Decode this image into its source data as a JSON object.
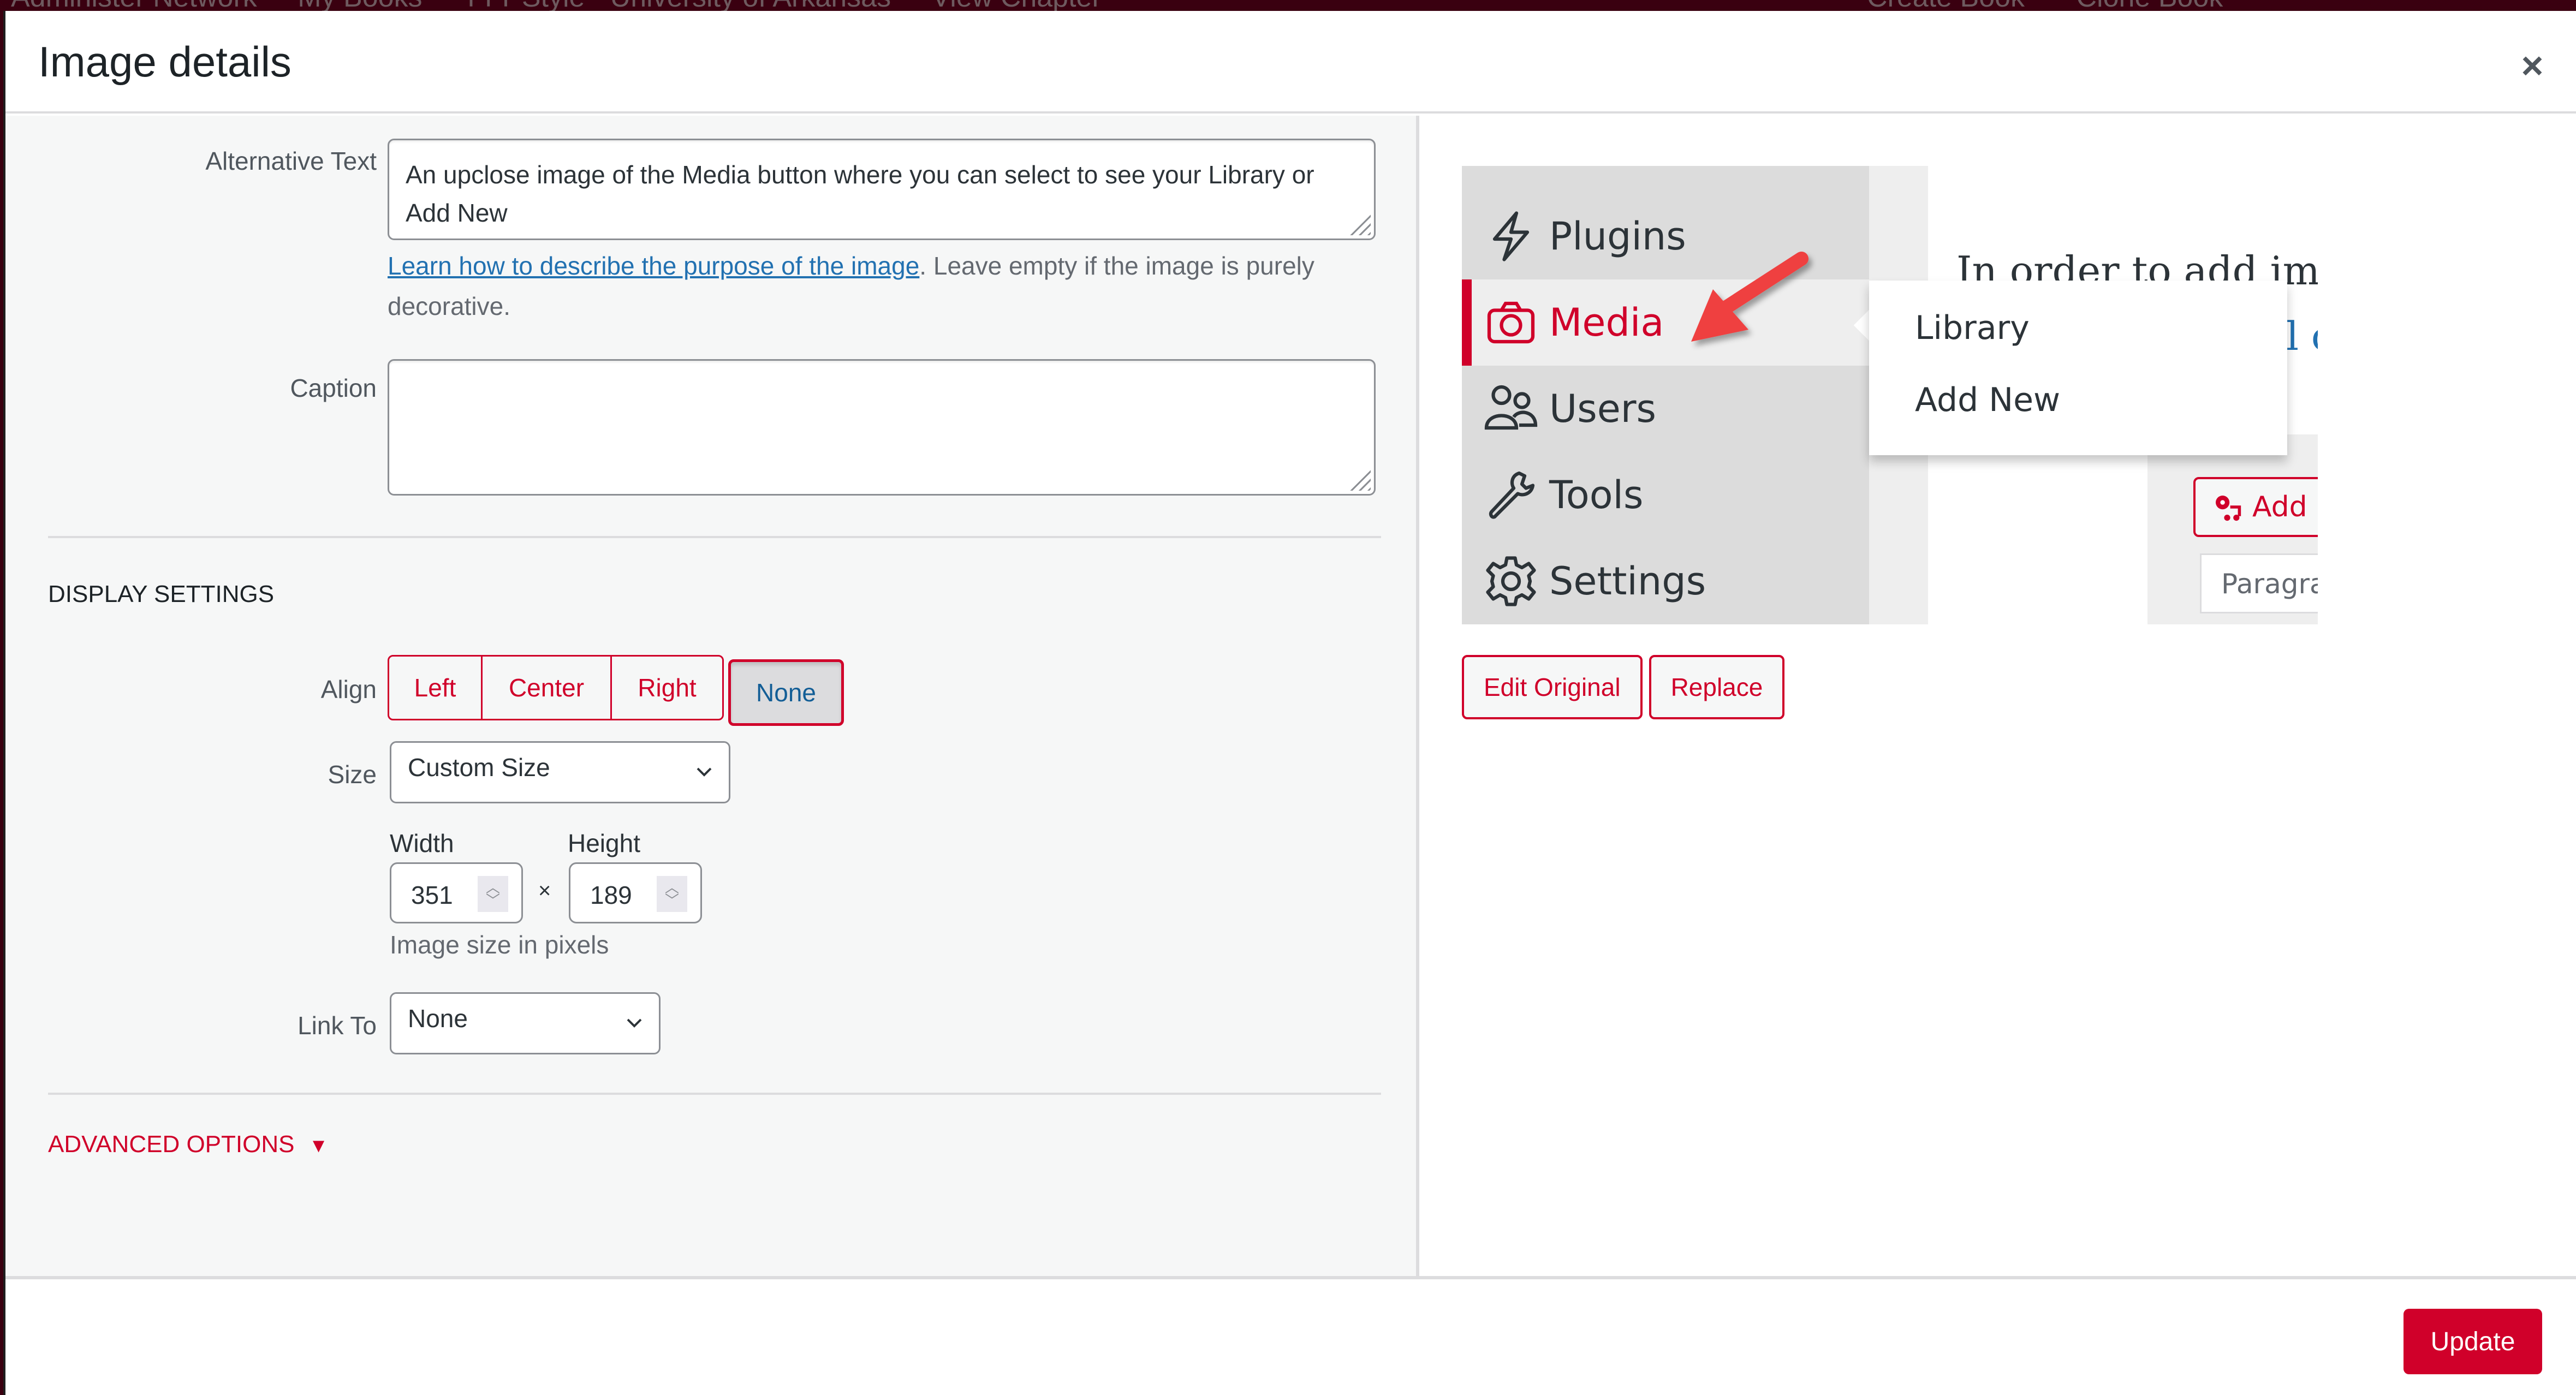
{
  "background_admin_bar": {
    "left_items": [
      "Administer Network",
      "My Books",
      "TTT Style - University of Arkansas",
      "View Chapter"
    ],
    "right_items": [
      "Create Book",
      "Clone Book"
    ]
  },
  "modal": {
    "title": "Image details",
    "close_label": "×"
  },
  "settings": {
    "alt_text": {
      "label": "Alternative Text",
      "value": "An upclose image of the Media button where you can select to see your Library or Add New",
      "help_link": "Learn how to describe the purpose of the image",
      "help_suffix": ". Leave empty if the image is purely decorative."
    },
    "caption": {
      "label": "Caption",
      "value": ""
    },
    "display_settings_title": "Display Settings",
    "align": {
      "label": "Align",
      "options": [
        "Left",
        "Center",
        "Right",
        "None"
      ],
      "selected": "None"
    },
    "size": {
      "label": "Size",
      "selected": "Custom Size"
    },
    "dimensions": {
      "width_label": "Width",
      "height_label": "Height",
      "width": "351",
      "height": "189",
      "separator": "×",
      "help": "Image size in pixels"
    },
    "link_to": {
      "label": "Link To",
      "selected": "None"
    },
    "advanced_options": "Advanced Options",
    "advanced_arrow": "▼"
  },
  "preview": {
    "menu_items": [
      {
        "label": "Plugins",
        "icon": "plugins-icon"
      },
      {
        "label": "Media",
        "icon": "camera-icon",
        "active": true
      },
      {
        "label": "Users",
        "icon": "users-icon"
      },
      {
        "label": "Tools",
        "icon": "wrench-icon"
      },
      {
        "label": "Settings",
        "icon": "gear-icon"
      }
    ],
    "flyout_items": [
      "Library",
      "Add New"
    ],
    "content_text_line1": "In order to add ima",
    "content_text_line2": "l c",
    "add_button": "Add",
    "paragraph_select": "Paragra",
    "buttons": {
      "edit_original": "Edit Original",
      "replace": "Replace"
    }
  },
  "footer": {
    "update_label": "Update"
  },
  "colors": {
    "accent": "#d0002a",
    "link": "#2271b1",
    "selected_text": "#135e96"
  }
}
